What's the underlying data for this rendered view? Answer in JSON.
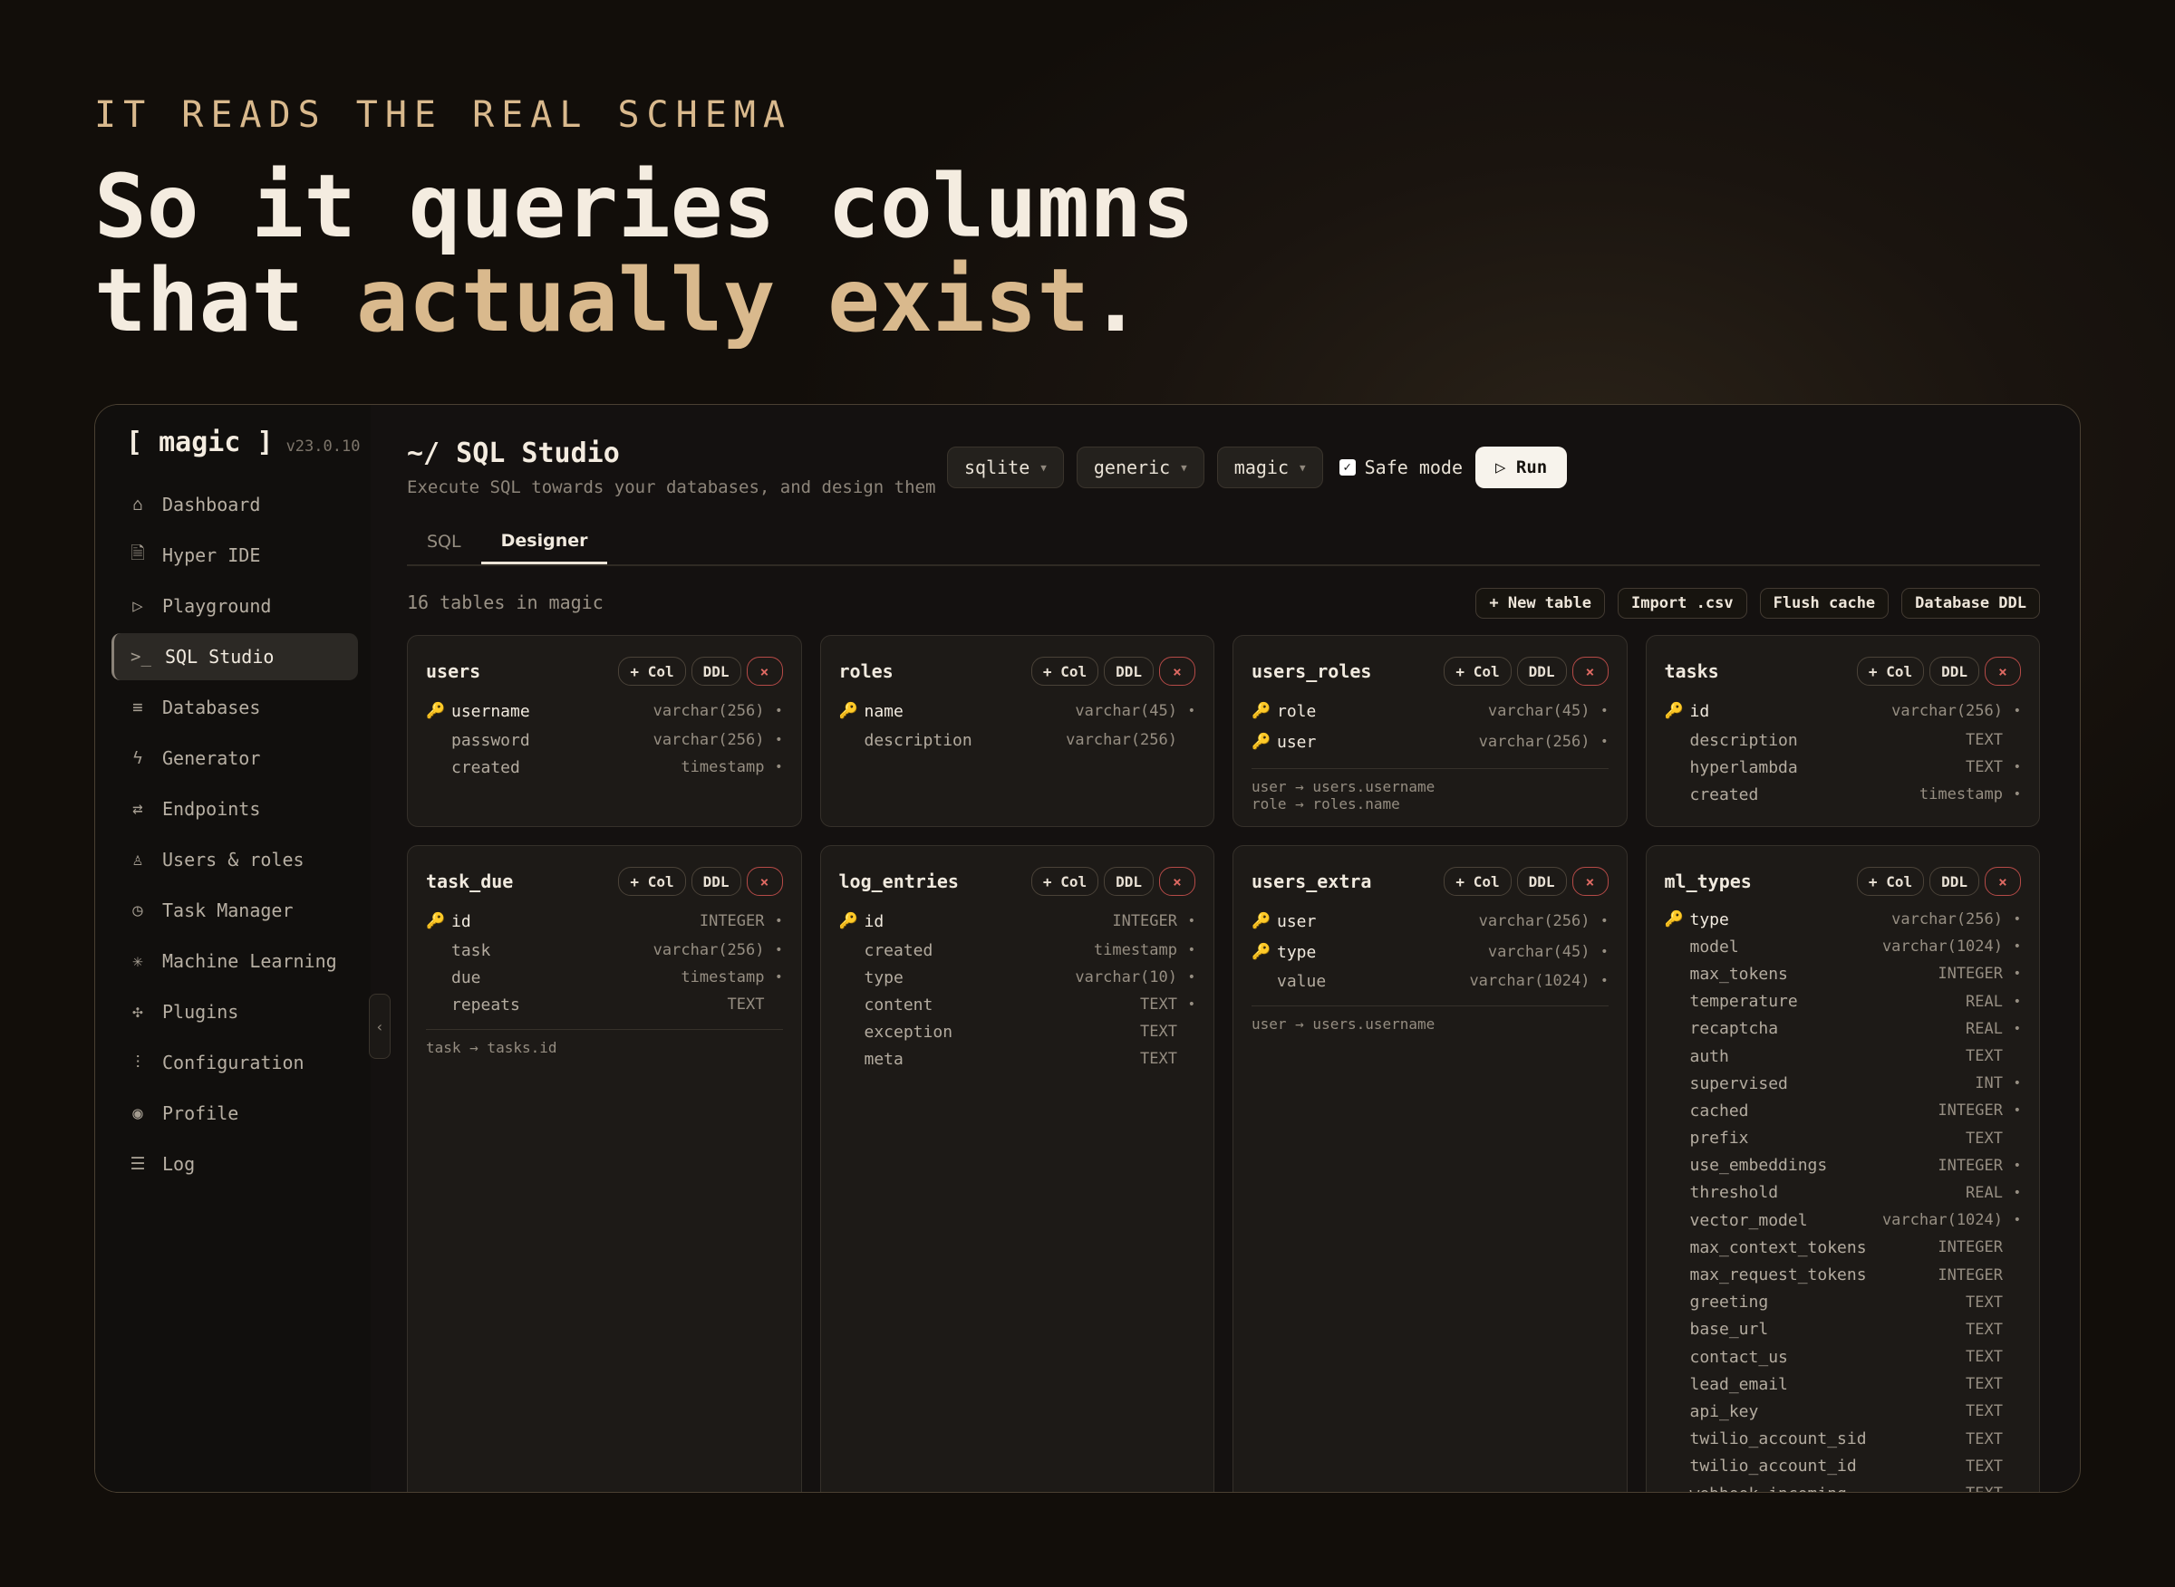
{
  "hero": {
    "eyebrow": "IT READS THE REAL SCHEMA",
    "line1": "So it queries columns",
    "line2_plain": "that ",
    "line2_accent": "actually exist",
    "line2_end": "."
  },
  "app": {
    "brand": "[ magic ]",
    "version": "v23.0.10"
  },
  "sidebar": {
    "items": [
      {
        "label": "Dashboard",
        "icon": "home-icon",
        "glyph": "⌂"
      },
      {
        "label": "Hyper IDE",
        "icon": "file-code-icon",
        "glyph": "🗎"
      },
      {
        "label": "Playground",
        "icon": "play-icon",
        "glyph": "▷"
      },
      {
        "label": "SQL Studio",
        "icon": "terminal-icon",
        "glyph": ">_",
        "active": true
      },
      {
        "label": "Databases",
        "icon": "database-icon",
        "glyph": "≡"
      },
      {
        "label": "Generator",
        "icon": "bolt-icon",
        "glyph": "ϟ"
      },
      {
        "label": "Endpoints",
        "icon": "arrows-icon",
        "glyph": "⇄"
      },
      {
        "label": "Users & roles",
        "icon": "user-icon",
        "glyph": "♙"
      },
      {
        "label": "Task Manager",
        "icon": "clock-icon",
        "glyph": "◷"
      },
      {
        "label": "Machine Learning",
        "icon": "sparkle-icon",
        "glyph": "✳"
      },
      {
        "label": "Plugins",
        "icon": "puzzle-icon",
        "glyph": "✣"
      },
      {
        "label": "Configuration",
        "icon": "sliders-icon",
        "glyph": "⫶"
      },
      {
        "label": "Profile",
        "icon": "profile-icon",
        "glyph": "◉"
      },
      {
        "label": "Log",
        "icon": "list-icon",
        "glyph": "☰"
      }
    ]
  },
  "header": {
    "title": "~/ SQL Studio",
    "subtitle": "Execute SQL towards your databases, and design them",
    "selects": [
      "sqlite",
      "generic",
      "magic"
    ],
    "safe_mode_label": "Safe mode",
    "run_label": "▷ Run"
  },
  "tabs": [
    "SQL",
    "Designer"
  ],
  "toolbar": {
    "count_text": "16 tables in magic",
    "actions": [
      "+ New table",
      "Import .csv",
      "Flush cache",
      "Database DDL"
    ]
  },
  "card_buttons": {
    "add_col": "+ Col",
    "ddl": "DDL",
    "delete": "×"
  },
  "tables": [
    {
      "name": "users",
      "columns": [
        {
          "name": "username",
          "type": "varchar(256)",
          "pk": true,
          "required": true
        },
        {
          "name": "password",
          "type": "varchar(256)",
          "required": true
        },
        {
          "name": "created",
          "type": "timestamp",
          "required": true
        }
      ],
      "fks": []
    },
    {
      "name": "roles",
      "columns": [
        {
          "name": "name",
          "type": "varchar(45)",
          "pk": true,
          "required": true
        },
        {
          "name": "description",
          "type": "varchar(256)"
        }
      ],
      "fks": []
    },
    {
      "name": "users_roles",
      "columns": [
        {
          "name": "role",
          "type": "varchar(45)",
          "pk": true,
          "required": true
        },
        {
          "name": "user",
          "type": "varchar(256)",
          "pk": true,
          "required": true
        }
      ],
      "fks": [
        "user → users.username",
        "role → roles.name"
      ]
    },
    {
      "name": "tasks",
      "columns": [
        {
          "name": "id",
          "type": "varchar(256)",
          "pk": true,
          "required": true
        },
        {
          "name": "description",
          "type": "TEXT"
        },
        {
          "name": "hyperlambda",
          "type": "TEXT",
          "required": true
        },
        {
          "name": "created",
          "type": "timestamp",
          "required": true
        }
      ],
      "fks": []
    },
    {
      "name": "task_due",
      "columns": [
        {
          "name": "id",
          "type": "INTEGER",
          "pk": true,
          "required": true
        },
        {
          "name": "task",
          "type": "varchar(256)",
          "required": true
        },
        {
          "name": "due",
          "type": "timestamp",
          "required": true
        },
        {
          "name": "repeats",
          "type": "TEXT"
        }
      ],
      "fks": [
        "task → tasks.id"
      ]
    },
    {
      "name": "log_entries",
      "columns": [
        {
          "name": "id",
          "type": "INTEGER",
          "pk": true,
          "required": true
        },
        {
          "name": "created",
          "type": "timestamp",
          "required": true
        },
        {
          "name": "type",
          "type": "varchar(10)",
          "required": true
        },
        {
          "name": "content",
          "type": "TEXT",
          "required": true
        },
        {
          "name": "exception",
          "type": "TEXT"
        },
        {
          "name": "meta",
          "type": "TEXT"
        }
      ],
      "fks": []
    },
    {
      "name": "users_extra",
      "columns": [
        {
          "name": "user",
          "type": "varchar(256)",
          "pk": true,
          "required": true
        },
        {
          "name": "type",
          "type": "varchar(45)",
          "pk": true,
          "required": true
        },
        {
          "name": "value",
          "type": "varchar(1024)",
          "required": true
        }
      ],
      "fks": [
        "user → users.username"
      ]
    },
    {
      "name": "ml_types",
      "columns": [
        {
          "name": "type",
          "type": "varchar(256)",
          "pk": true,
          "required": true
        },
        {
          "name": "model",
          "type": "varchar(1024)",
          "required": true
        },
        {
          "name": "max_tokens",
          "type": "INTEGER",
          "required": true
        },
        {
          "name": "temperature",
          "type": "REAL",
          "required": true
        },
        {
          "name": "recaptcha",
          "type": "REAL",
          "required": true
        },
        {
          "name": "auth",
          "type": "TEXT"
        },
        {
          "name": "supervised",
          "type": "INT",
          "required": true
        },
        {
          "name": "cached",
          "type": "INTEGER",
          "required": true
        },
        {
          "name": "prefix",
          "type": "TEXT"
        },
        {
          "name": "use_embeddings",
          "type": "INTEGER",
          "required": true
        },
        {
          "name": "threshold",
          "type": "REAL",
          "required": true
        },
        {
          "name": "vector_model",
          "type": "varchar(1024)",
          "required": true
        },
        {
          "name": "max_context_tokens",
          "type": "INTEGER"
        },
        {
          "name": "max_request_tokens",
          "type": "INTEGER"
        },
        {
          "name": "greeting",
          "type": "TEXT"
        },
        {
          "name": "base_url",
          "type": "TEXT"
        },
        {
          "name": "contact_us",
          "type": "TEXT"
        },
        {
          "name": "lead_email",
          "type": "TEXT"
        },
        {
          "name": "api_key",
          "type": "TEXT"
        },
        {
          "name": "twilio_account_sid",
          "type": "TEXT"
        },
        {
          "name": "twilio_account_id",
          "type": "TEXT"
        },
        {
          "name": "webhook_incoming",
          "type": "TEXT"
        }
      ],
      "fks": []
    }
  ],
  "colors": {
    "accent": "#d9b98d",
    "key": "#d9a441",
    "danger": "#e06a63",
    "background": "#141110"
  }
}
